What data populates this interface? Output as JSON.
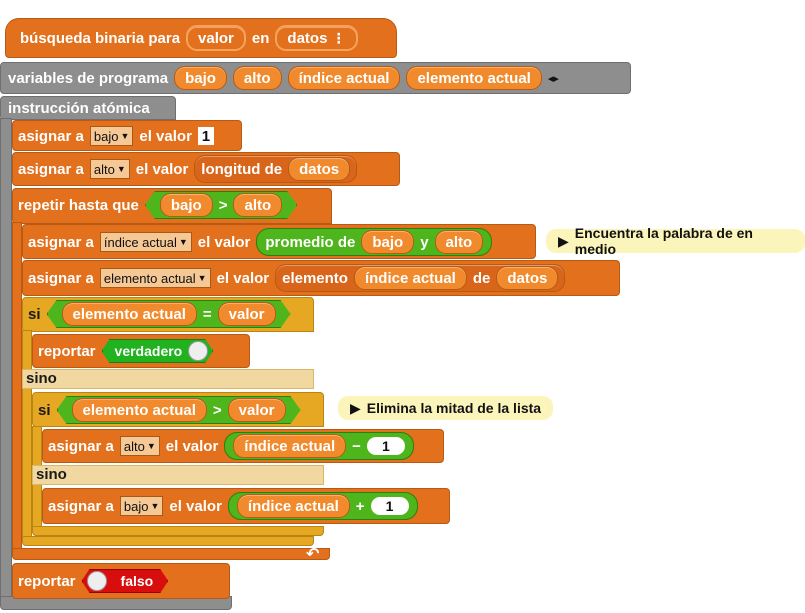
{
  "hat": {
    "label": "búsqueda binaria para",
    "param1": "valor",
    "en": "en",
    "param2": "datos",
    "menu_glyph": "⋮"
  },
  "vars": {
    "label": "variables de programa",
    "items": [
      "bajo",
      "alto",
      "índice actual",
      "elemento actual"
    ],
    "arrows": "◂▸"
  },
  "atomic": {
    "label": "instrucción atómica"
  },
  "assign": {
    "label": "asignar a",
    "value_label": "el valor"
  },
  "set_bajo": {
    "var": "bajo",
    "value": "1"
  },
  "set_alto": {
    "var": "alto",
    "fn": "longitud de",
    "arg": "datos"
  },
  "repeat": {
    "label": "repetir hasta que",
    "left": "bajo",
    "op": ">",
    "right": "alto"
  },
  "set_indice": {
    "var": "índice actual",
    "fn": "promedio de",
    "a": "bajo",
    "y": "y",
    "b": "alto"
  },
  "comment1": "Encuentra la palabra de en medio",
  "set_elemento": {
    "var": "elemento actual",
    "fn": "elemento",
    "idx": "índice actual",
    "de": "de",
    "list": "datos"
  },
  "if1": {
    "si": "si",
    "left": "elemento actual",
    "op": "=",
    "right": "valor"
  },
  "report_true": {
    "label": "reportar",
    "value": "verdadero"
  },
  "else1": "sino",
  "if2": {
    "si": "si",
    "left": "elemento actual",
    "op": ">",
    "right": "valor"
  },
  "comment2": "Elimina la mitad de la lista",
  "set_alto2": {
    "var": "alto",
    "left": "índice actual",
    "op": "−",
    "right": "1"
  },
  "else2": "sino",
  "set_bajo2": {
    "var": "bajo",
    "left": "índice actual",
    "op": "+",
    "right": "1"
  },
  "loop_arrow": "↶",
  "report_false": {
    "label": "reportar",
    "value": "falso"
  }
}
